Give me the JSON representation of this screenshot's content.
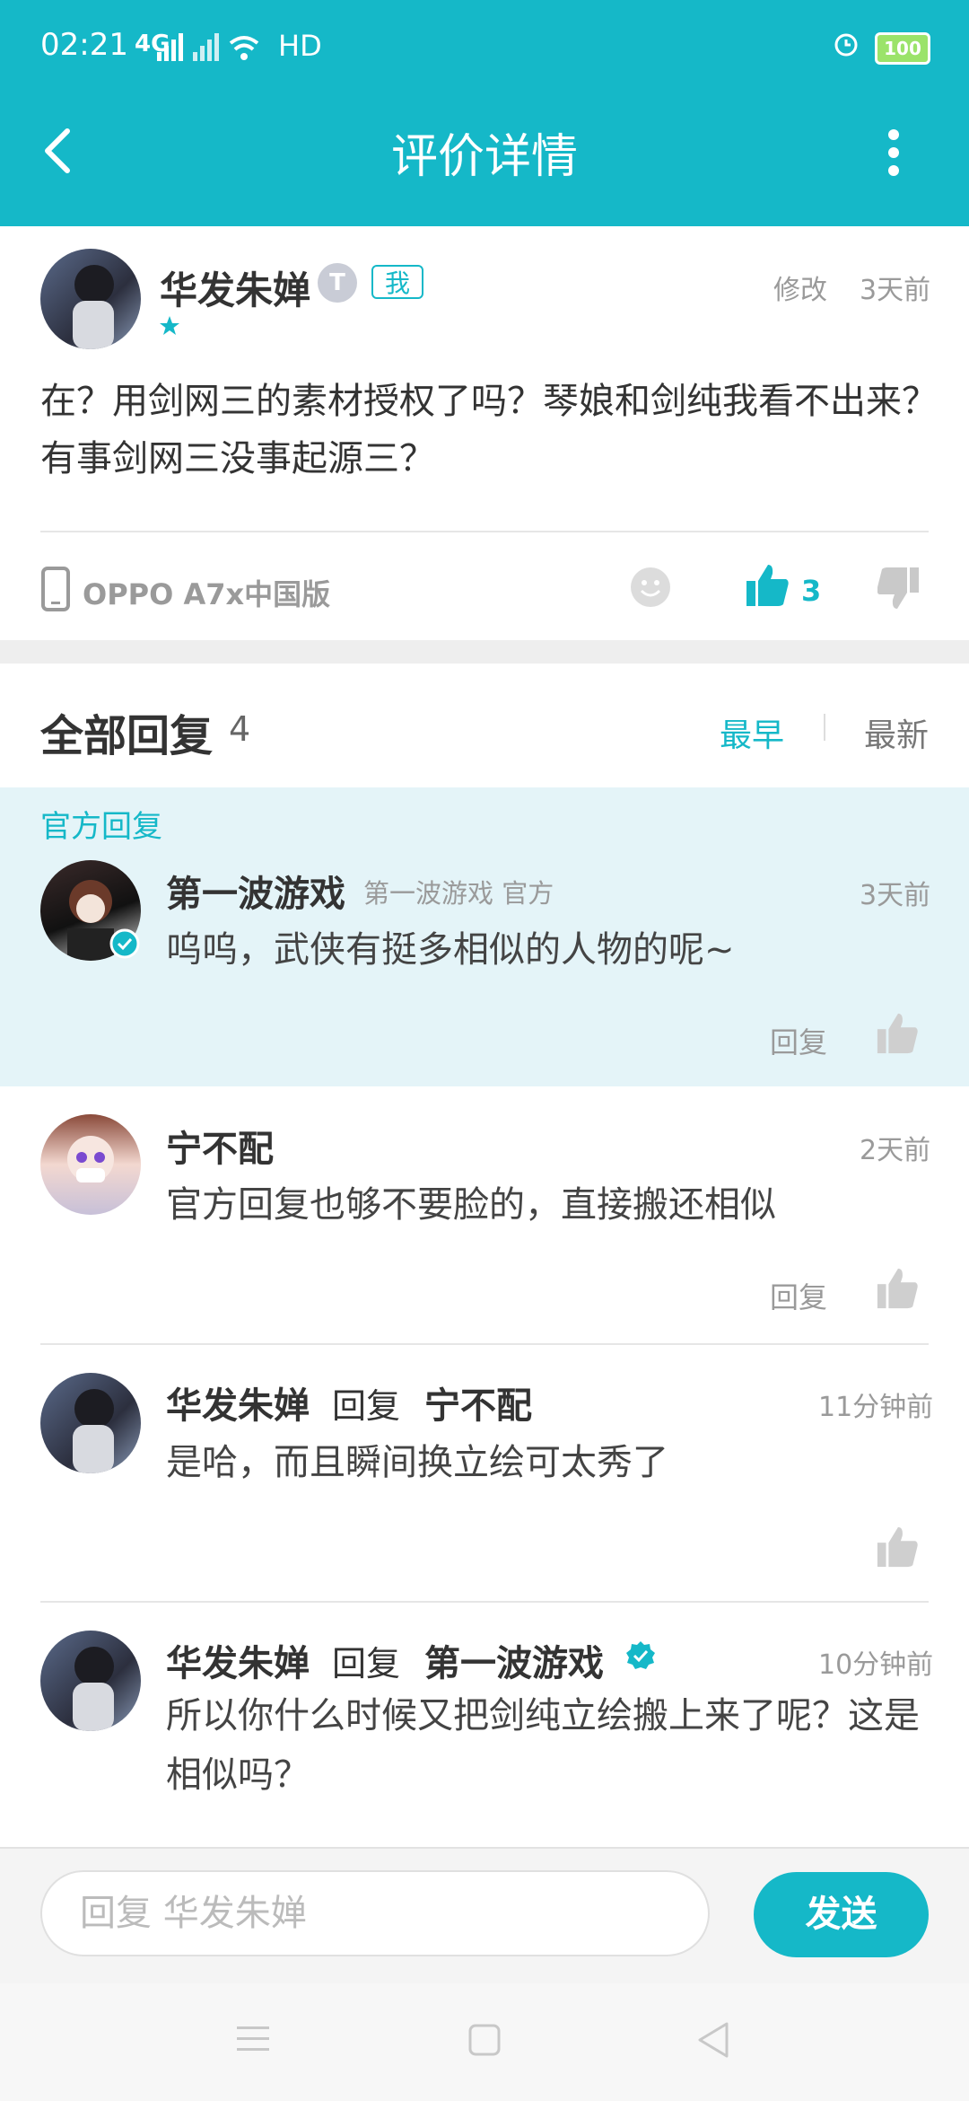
{
  "status_bar": {
    "time": "02:21",
    "network": "4G",
    "hd": "HD",
    "battery": "100"
  },
  "header": {
    "title": "评价详情"
  },
  "review": {
    "author": "华发朱婵",
    "level_badge": "T",
    "me_badge": "我",
    "edit_label": "修改",
    "time": "3天前",
    "text": "在？用剑网三的素材授权了吗？琴娘和剑纯我看不出来？有事剑网三没事起源三？",
    "device": "OPPO A7x中国版",
    "like_count": "3",
    "rating_stars": 1
  },
  "replies_section": {
    "title": "全部回复",
    "count": "4",
    "sort_early": "最早",
    "sort_new": "最新",
    "official_label": "官方回复"
  },
  "replies": [
    {
      "name": "第一波游戏",
      "sub": "第一波游戏 官方",
      "time": "3天前",
      "text": "呜呜，武侠有挺多相似的人物的呢~",
      "reply_label": "回复"
    },
    {
      "name": "宁不配",
      "time": "2天前",
      "text": "官方回复也够不要脸的，直接搬还相似",
      "reply_label": "回复"
    },
    {
      "name": "华发朱婵",
      "reply_word": "回复",
      "target": "宁不配",
      "time": "11分钟前",
      "text": "是哈，而且瞬间换立绘可太秀了"
    },
    {
      "name": "华发朱婵",
      "reply_word": "回复",
      "target": "第一波游戏",
      "time": "10分钟前",
      "text": "所以你什么时候又把剑纯立绘搬上来了呢？这是相似吗？"
    }
  ],
  "composer": {
    "placeholder": "回复 华发朱婵",
    "send_label": "发送"
  },
  "colors": {
    "accent": "#15b8c8",
    "official_bg": "#e4f4f8"
  }
}
